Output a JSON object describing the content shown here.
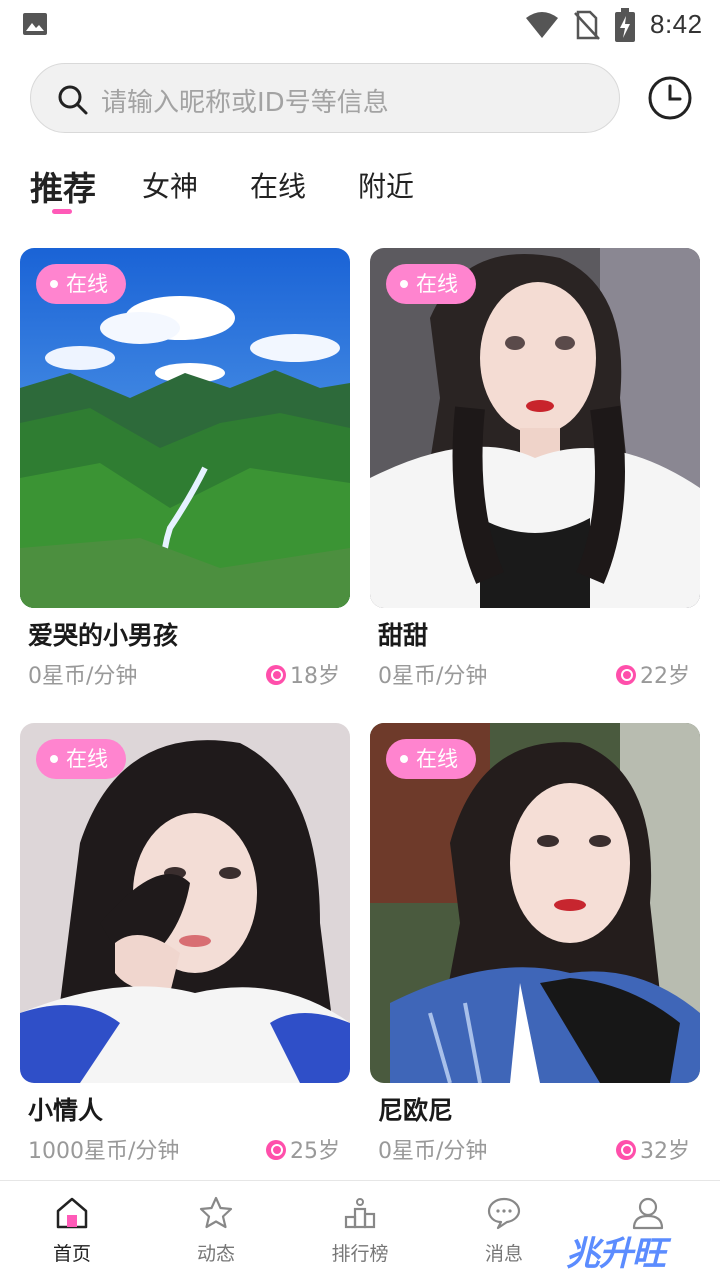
{
  "status_bar": {
    "time": "8:42"
  },
  "search": {
    "placeholder": "请输入昵称或ID号等信息"
  },
  "tabs": [
    {
      "label": "推荐",
      "active": true
    },
    {
      "label": "女神",
      "active": false
    },
    {
      "label": "在线",
      "active": false
    },
    {
      "label": "附近",
      "active": false
    }
  ],
  "cards": [
    {
      "badge": "在线",
      "name": "爱哭的小男孩",
      "price": "0星币/分钟",
      "age": "18岁",
      "photo": "mountain-landscape"
    },
    {
      "badge": "在线",
      "name": "甜甜",
      "price": "0星币/分钟",
      "age": "22岁",
      "photo": "woman-portrait"
    },
    {
      "badge": "在线",
      "name": "小情人",
      "price": "1000星币/分钟",
      "age": "25岁",
      "photo": "woman-portrait"
    },
    {
      "badge": "在线",
      "name": "尼欧尼",
      "price": "0星币/分钟",
      "age": "32岁",
      "photo": "woman-portrait"
    }
  ],
  "bottom_nav": [
    {
      "label": "首页",
      "icon": "home-icon",
      "active": true
    },
    {
      "label": "动态",
      "icon": "star-icon",
      "active": false
    },
    {
      "label": "排行榜",
      "icon": "podium-icon",
      "active": false
    },
    {
      "label": "消息",
      "icon": "chat-icon",
      "active": false
    },
    {
      "label": "",
      "icon": "profile-icon",
      "active": false
    }
  ],
  "watermark": "兆升旺",
  "colors": {
    "accent": "#ff5ab8",
    "badge": "#ff84cf",
    "gender": "#ff4fab"
  }
}
